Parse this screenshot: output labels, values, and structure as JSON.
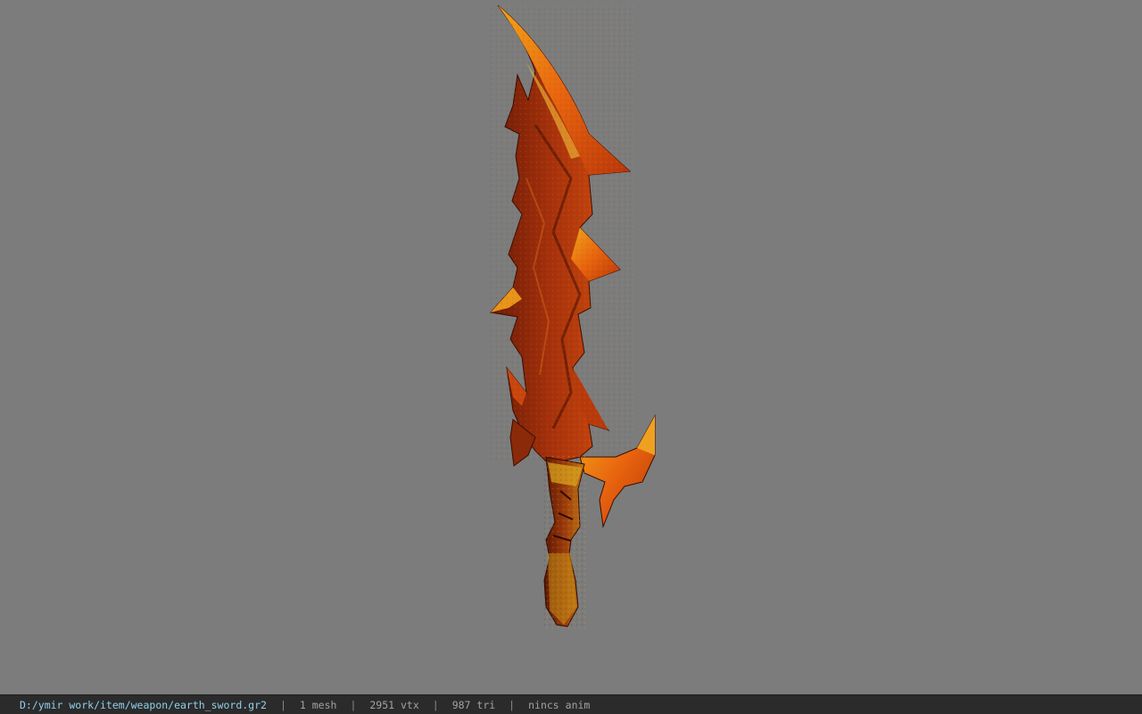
{
  "viewer": {
    "background_color": "#7c7c7c",
    "model_name": "earth_sword"
  },
  "status_bar": {
    "file_path": "D:/ymir work/item/weapon/earth_sword.gr2",
    "separator": "|",
    "mesh_count": "1 mesh",
    "vertex_count": "2951 vtx",
    "triangle_count": "987 tri",
    "anim_status": "nincs anim",
    "path_color": "#8fd0ec",
    "text_color": "#a2a2a2"
  }
}
